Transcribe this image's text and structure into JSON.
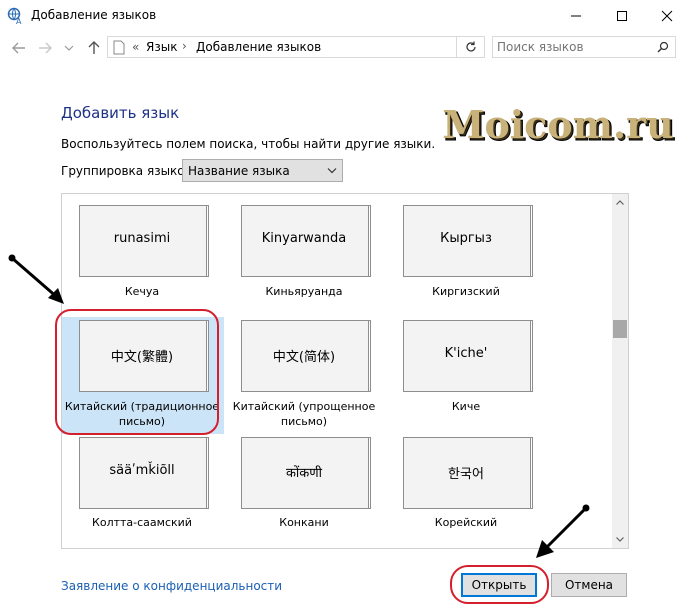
{
  "window": {
    "title": "Добавление языков"
  },
  "breadcrumb": {
    "prefix": "«",
    "items": [
      "Язык",
      "Добавление языков"
    ],
    "separator": "›"
  },
  "search": {
    "placeholder": "Поиск языков"
  },
  "page": {
    "heading": "Добавить язык",
    "description": "Воспользуйтесь полем поиска, чтобы найти другие языки.",
    "grouping_label": "Группировка языков:",
    "grouping_value": "Название языка"
  },
  "languages": [
    {
      "native": "runasimi",
      "caption": [
        "Кечуа"
      ]
    },
    {
      "native": "Kinyarwanda",
      "caption": [
        "Киньяруанда"
      ]
    },
    {
      "native": "Кыргыз",
      "caption": [
        "Киргизский"
      ]
    },
    {
      "native": "中文(繁體)",
      "caption": [
        "Китайский (традиционное",
        "письмо)"
      ],
      "selected": true
    },
    {
      "native": "中文(简体)",
      "caption": [
        "Китайский (упрощенное",
        "письмо)"
      ]
    },
    {
      "native": "K'iche'",
      "caption": [
        "Киче"
      ]
    },
    {
      "native": "sääʹmǩiõll",
      "caption": [
        "Колтта-саамский"
      ]
    },
    {
      "native": "कोंकणी",
      "caption": [
        "Конкани"
      ]
    },
    {
      "native": "한국어",
      "caption": [
        "Корейский"
      ]
    }
  ],
  "footer": {
    "privacy_link": "Заявление о конфиденциальности",
    "open_label": "Открыть",
    "cancel_label": "Отмена"
  },
  "watermark": "Moicom.ru",
  "colors": {
    "heading": "#1e3287",
    "link": "#1a5fb4",
    "annotation": "#d4202c",
    "selection": "#cce4f7",
    "focus": "#0078d7"
  }
}
